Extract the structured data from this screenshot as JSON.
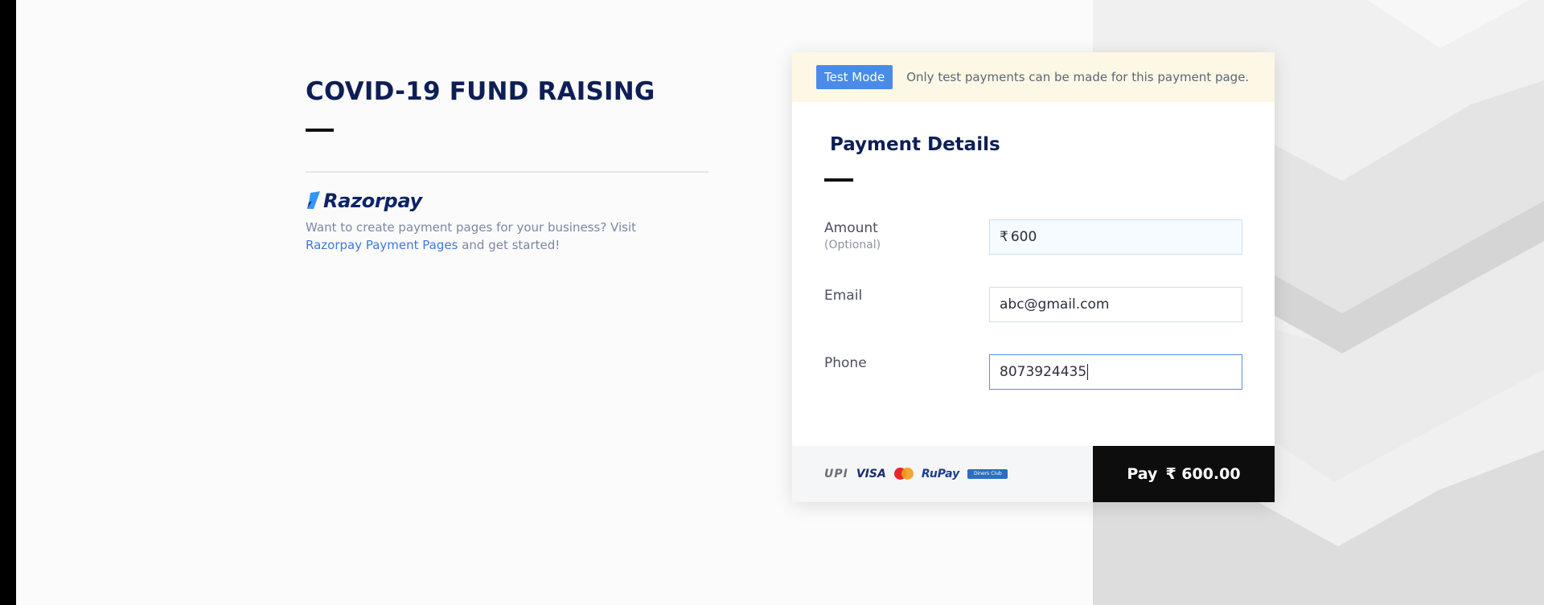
{
  "page": {
    "title": "COVID-19 FUND RAISING"
  },
  "brand": {
    "logo_text": "Razorpay",
    "promo_text": "Want to create payment pages for your business? Visit",
    "promo_link": "Razorpay Payment Pages",
    "promo_suffix": "and get started!"
  },
  "card": {
    "test_mode_badge": "Test Mode",
    "test_mode_note": "Only test payments can be made for this payment page.",
    "title": "Payment Details",
    "fields": {
      "amount": {
        "label": "Amount",
        "sublabel": "(Optional)",
        "currency": "₹",
        "value": "600"
      },
      "email": {
        "label": "Email",
        "value": "abc@gmail.com"
      },
      "phone": {
        "label": "Phone",
        "value": "8073924435"
      }
    },
    "payment_methods": {
      "upi": "UPI",
      "visa": "VISA",
      "rupay": "RuPay",
      "diners": "Diners Club"
    },
    "pay_button": {
      "label": "Pay",
      "amount": "₹ 600.00"
    }
  },
  "colors": {
    "title": "#0e1f55",
    "accent_blue": "#4a8be8",
    "test_banner_bg": "#fcf8e5",
    "pay_button_bg": "#0d0d0d"
  }
}
